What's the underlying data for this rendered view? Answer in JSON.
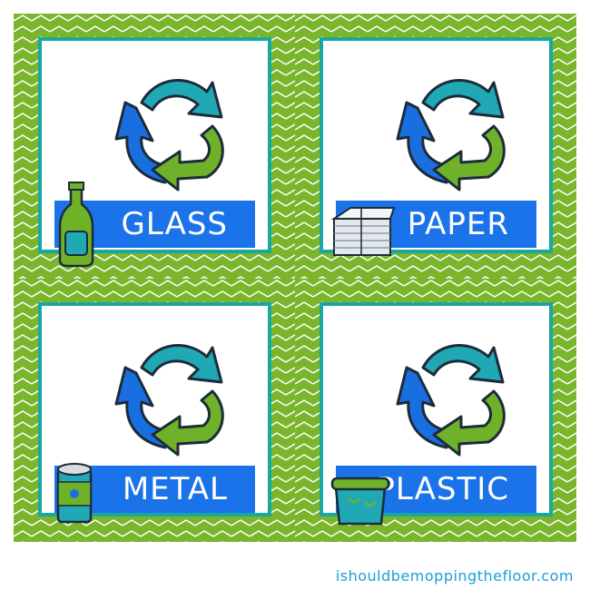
{
  "cards": [
    {
      "label": "GLASS",
      "item_icon": "glass-bottle-icon"
    },
    {
      "label": "PAPER",
      "item_icon": "newspaper-stack-icon"
    },
    {
      "label": "METAL",
      "item_icon": "tin-can-icon"
    },
    {
      "label": "PLASTIC",
      "item_icon": "plastic-container-icon"
    }
  ],
  "footer": {
    "text": "ishouldbemoppingthefloor.com"
  },
  "colors": {
    "border_green": "#7ab52c",
    "teal": "#19a7a4",
    "label_blue": "#1a73e8",
    "arrow_teal": "#20a8b4",
    "arrow_blue": "#1a6fe0",
    "arrow_green": "#6fb22a",
    "footer_blue": "#1a9fd6"
  }
}
